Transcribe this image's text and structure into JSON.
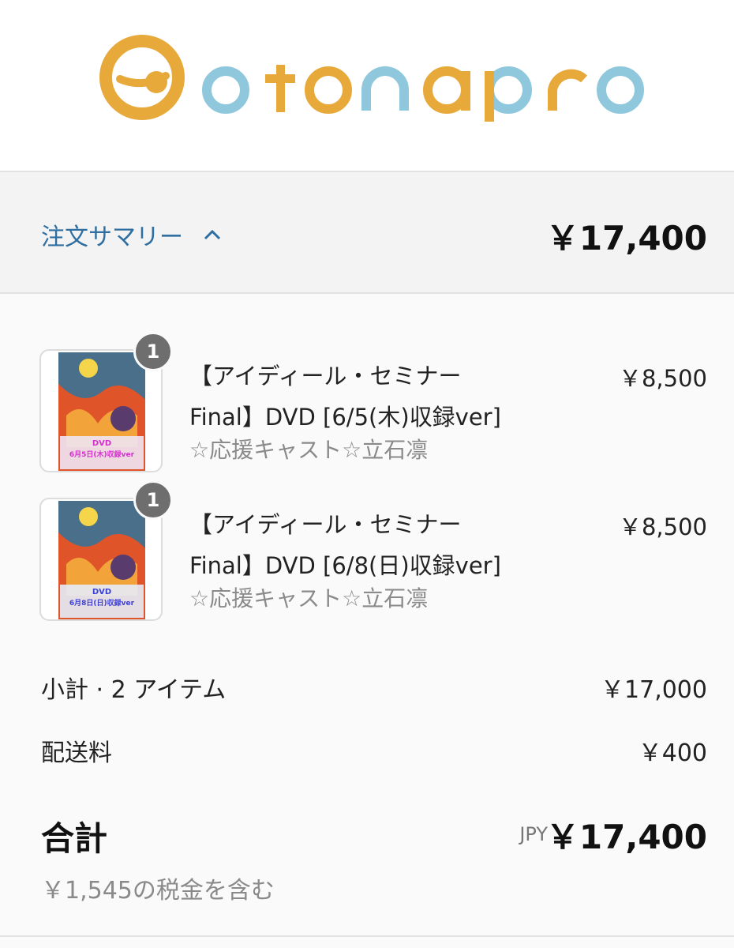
{
  "brand": {
    "name": "otonapro",
    "colors": {
      "orange": "#e8a93b",
      "blue": "#8fc7dc"
    }
  },
  "summary": {
    "toggle_label": "注文サマリー",
    "toggle_icon": "chevron-up-icon",
    "total": "￥17,400"
  },
  "items": [
    {
      "quantity": "1",
      "title_line1": "【アイディール・セミナー",
      "title_line2": "Final】DVD [6/5(木)収録ver]",
      "variant": "☆応援キャスト☆立石凛",
      "price": "￥8,500",
      "thumb_caption": "DVD",
      "thumb_date": "6月5日(木)収録ver"
    },
    {
      "quantity": "1",
      "title_line1": "【アイディール・セミナー",
      "title_line2": "Final】DVD [6/8(日)収録ver]",
      "variant": "☆応援キャスト☆立石凛",
      "price": "￥8,500",
      "thumb_caption": "DVD",
      "thumb_date": "6月8日(日)収録ver"
    }
  ],
  "subtotal": {
    "label": "小計 · 2 アイテム",
    "value": "￥17,000"
  },
  "shipping": {
    "label": "配送料",
    "value": "￥400"
  },
  "total": {
    "label": "合計",
    "currency": "JPY",
    "value": "￥17,400"
  },
  "tax_note": "￥1,545の税金を含む"
}
